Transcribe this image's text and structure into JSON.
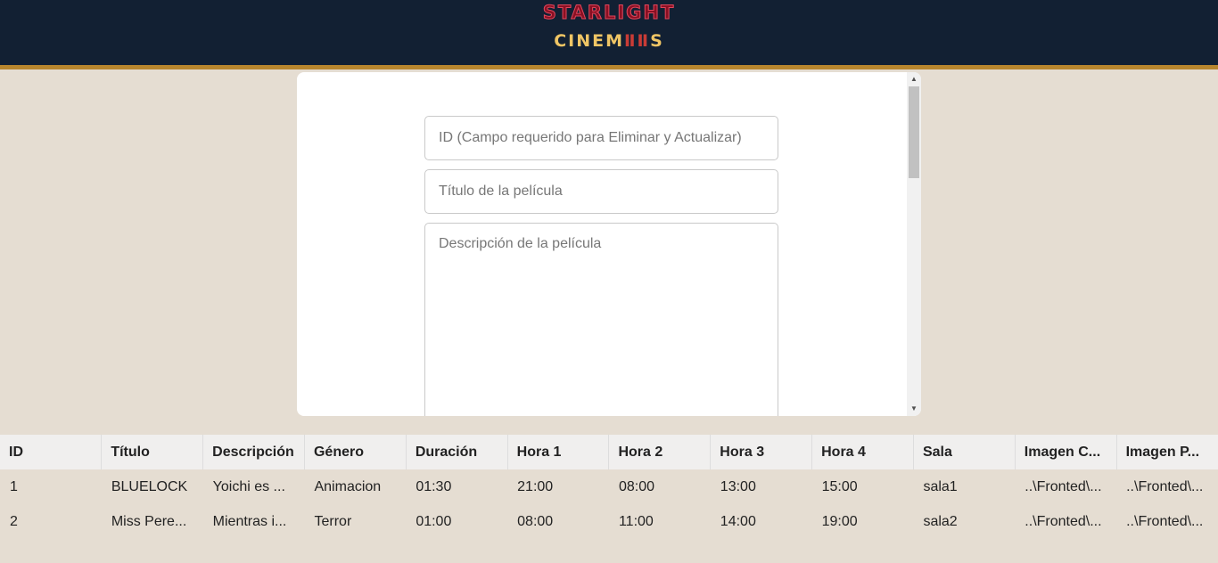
{
  "header": {
    "logo_top": "STARLIGHT",
    "logo_bottom_left": "CINEM",
    "logo_bottom_mark": "ⅡⅡ",
    "logo_bottom_right": "S"
  },
  "form": {
    "id_placeholder": "ID (Campo requerido para Eliminar y Actualizar)",
    "title_placeholder": "Título de la película",
    "description_placeholder": "Descripción de la película"
  },
  "table": {
    "columns": [
      "ID",
      "Título",
      "Descripción",
      "Género",
      "Duración",
      "Hora 1",
      "Hora 2",
      "Hora 3",
      "Hora 4",
      "Sala",
      "Imagen C...",
      "Imagen P..."
    ],
    "rows": [
      [
        "1",
        "BLUELOCK",
        "Yoichi es ...",
        "Animacion",
        "01:30",
        "21:00",
        "08:00",
        "13:00",
        "15:00",
        "sala1",
        "..\\Fronted\\...",
        "..\\Fronted\\..."
      ],
      [
        "2",
        "Miss Pere...",
        "Mientras i...",
        "Terror",
        "01:00",
        "08:00",
        "11:00",
        "14:00",
        "19:00",
        "sala2",
        "..\\Fronted\\...",
        "..\\Fronted\\..."
      ]
    ]
  },
  "colors": {
    "header_bg": "#122033",
    "header_border": "#b8862e",
    "page_bg": "#e5ddd2",
    "logo_red": "#8a1023",
    "logo_gold": "#efc565"
  }
}
